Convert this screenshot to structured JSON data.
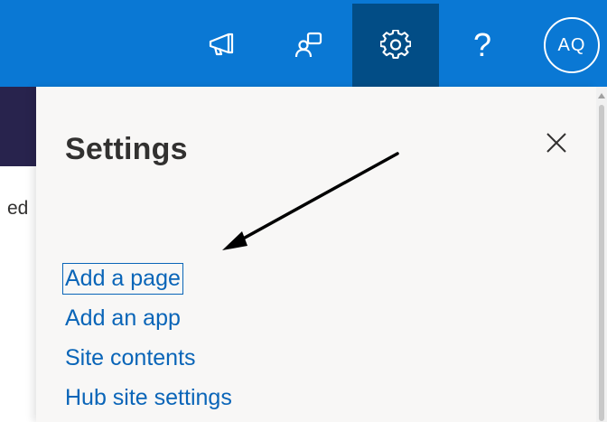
{
  "topbar": {
    "background": "#0a78d4",
    "active_background": "#024d86",
    "buttons": [
      {
        "icon": "megaphone-icon"
      },
      {
        "icon": "chat-feedback-icon"
      },
      {
        "icon": "gear-icon",
        "active": true
      },
      {
        "icon": "help-icon",
        "glyph": "?"
      }
    ],
    "avatar_initials": "AQ"
  },
  "page": {
    "fragment_text": "ed"
  },
  "settings_panel": {
    "title": "Settings",
    "close_icon": "close-icon",
    "links": [
      {
        "label": "Add a page",
        "focused": true
      },
      {
        "label": "Add an app"
      },
      {
        "label": "Site contents"
      },
      {
        "label": "Hub site settings"
      }
    ]
  },
  "colors": {
    "link": "#0a65b8",
    "panel_bg": "#f8f7f6",
    "site_header": "#28234d",
    "text": "#323130"
  }
}
